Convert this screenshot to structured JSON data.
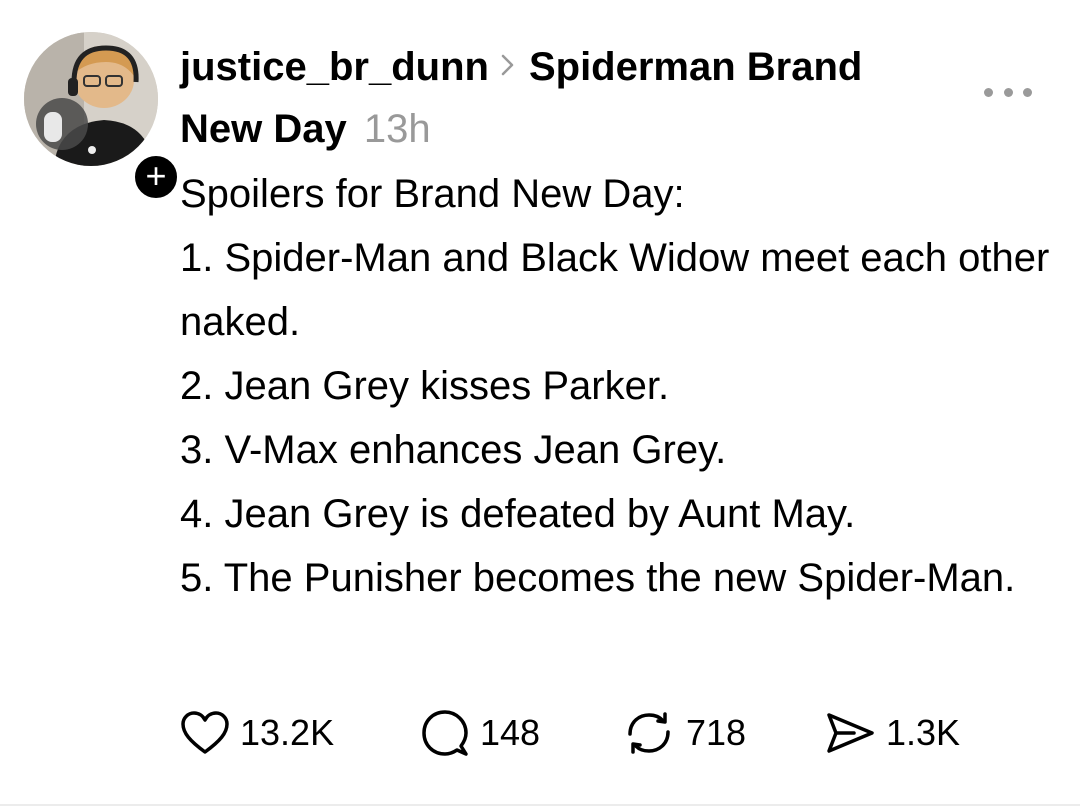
{
  "post": {
    "username": "justice_br_dunn",
    "thread": "Spiderman Brand New Day",
    "time": "13h",
    "lines": [
      "Spoilers for Brand New Day:",
      "1. Spider-Man and Black Widow meet each other naked.",
      "2. Jean Grey kisses Parker.",
      "3. V-Max enhances Jean Grey.",
      "4. Jean Grey is defeated by Aunt May.",
      "5. The Punisher becomes the new Spider-Man."
    ]
  },
  "actions": {
    "likes": "13.2K",
    "replies": "148",
    "reposts": "718",
    "shares": "1.3K"
  },
  "icons": {
    "like": "heart-icon",
    "reply": "speech-bubble-icon",
    "repost": "repost-arrows-icon",
    "share": "paper-plane-icon",
    "more": "more-dots-icon",
    "follow": "plus-icon",
    "chevron": "chevron-right-icon"
  },
  "colors": {
    "text": "#000000",
    "muted": "#999999",
    "background": "#ffffff"
  }
}
